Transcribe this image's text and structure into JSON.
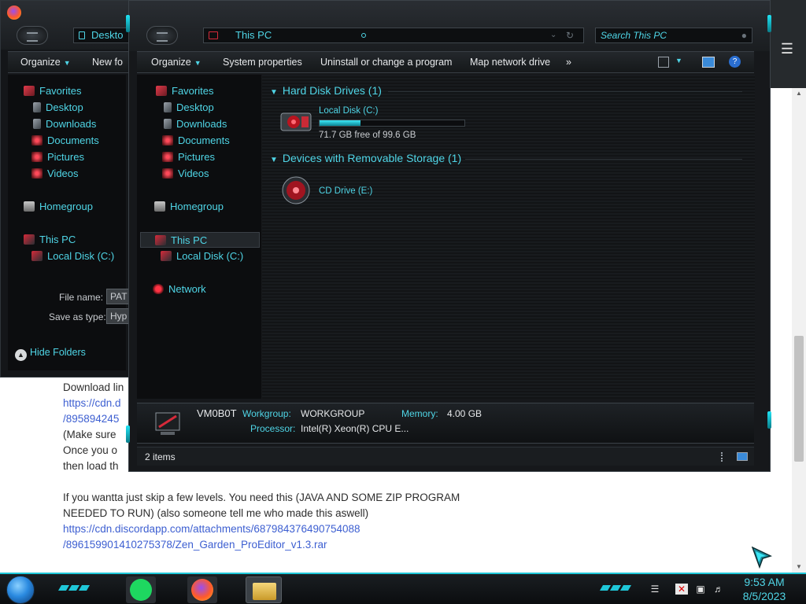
{
  "webpage": {
    "lines": [
      "Download lin",
      "https://cdn.d",
      "/895894245",
      "(Make sure",
      "Once you o",
      "then load th"
    ],
    "paragraph2_line1": "If you wantta just skip a few levels. You need this (JAVA AND SOME ZIP PROGRAM",
    "paragraph2_line2": "NEEDED TO RUN) (also someone tell me who made this aswell)",
    "link_line1": "https://cdn.discordapp.com/attachments/687984376490754088",
    "link_line2": "/896159901410275378/Zen_Garden_ProEditor_v1.3.rar",
    "menu_icon": "hamburger-icon"
  },
  "back_window": {
    "address": "Deskto",
    "toolbar": {
      "organize": "Organize",
      "new_folder": "New fo"
    },
    "nav": {
      "favorites": "Favorites",
      "desktop": "Desktop",
      "downloads": "Downloads",
      "documents": "Documents",
      "pictures": "Pictures",
      "videos": "Videos",
      "homegroup": "Homegroup",
      "this_pc": "This PC",
      "local_disk": "Local Disk (C:)"
    },
    "file_name_label": "File name:",
    "file_name_value": "PAT",
    "save_type_label": "Save as type:",
    "save_type_value": "Hyp",
    "hide_folders": "Hide Folders"
  },
  "front_window": {
    "address": "This PC",
    "search_placeholder": "Search This PC",
    "toolbar": {
      "organize": "Organize",
      "system_properties": "System properties",
      "uninstall": "Uninstall or change a program",
      "map_network": "Map network drive",
      "more": "»"
    },
    "nav": {
      "favorites": "Favorites",
      "desktop": "Desktop",
      "downloads": "Downloads",
      "documents": "Documents",
      "pictures": "Pictures",
      "videos": "Videos",
      "homegroup": "Homegroup",
      "this_pc": "This PC",
      "local_disk": "Local Disk (C:)",
      "network": "Network"
    },
    "groups": {
      "hdd": "Hard Disk Drives (1)",
      "removable": "Devices with Removable Storage (1)"
    },
    "local_disk": {
      "name": "Local Disk (C:)",
      "free_text": "71.7 GB free of 99.6 GB",
      "used_fraction": 0.28
    },
    "cd_drive": {
      "name": "CD Drive (E:)"
    },
    "details": {
      "computer_name": "VM0B0T",
      "workgroup_label": "Workgroup:",
      "workgroup_value": "WORKGROUP",
      "memory_label": "Memory:",
      "memory_value": "4.00 GB",
      "processor_label": "Processor:",
      "processor_value": "Intel(R) Xeon(R) CPU E..."
    },
    "status": "2 items"
  },
  "taskbar": {
    "time": "9:53 AM",
    "date": "8/5/2023",
    "accent": "#1fc7d8"
  }
}
